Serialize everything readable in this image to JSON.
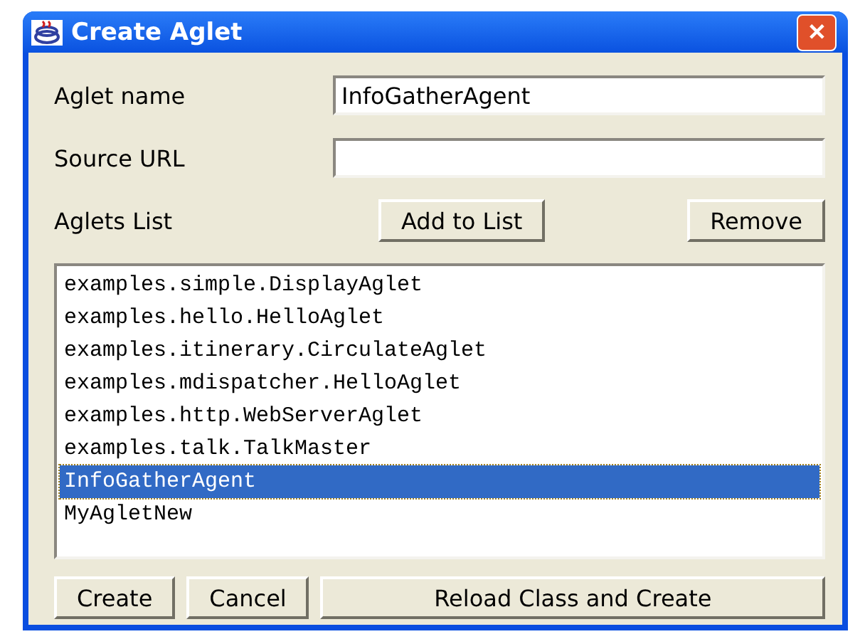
{
  "window": {
    "title": "Create Aglet",
    "close": "✕"
  },
  "fields": [
    {
      "label": "Aglet name",
      "value": "InfoGatherAgent"
    },
    {
      "label": "Source URL"
    }
  ],
  "list_label": "Aglets List",
  "list_buttons": [
    "Add to List",
    "Remove"
  ],
  "aglets": [
    {
      "name": "examples.simple.DisplayAglet",
      "selected": false
    },
    {
      "name": "examples.hello.HelloAglet",
      "selected": false
    },
    {
      "name": "examples.itinerary.CirculateAglet",
      "selected": false
    },
    {
      "name": "examples.mdispatcher.HelloAglet",
      "selected": false
    },
    {
      "name": "examples.http.WebServerAglet",
      "selected": false
    },
    {
      "name": "examples.talk.TalkMaster",
      "selected": false
    },
    {
      "name": "InfoGatherAgent",
      "selected": true
    },
    {
      "name": "MyAgletNew",
      "selected": false
    }
  ],
  "buttons": [
    "Create",
    "Cancel",
    "Reload Class and Create"
  ]
}
